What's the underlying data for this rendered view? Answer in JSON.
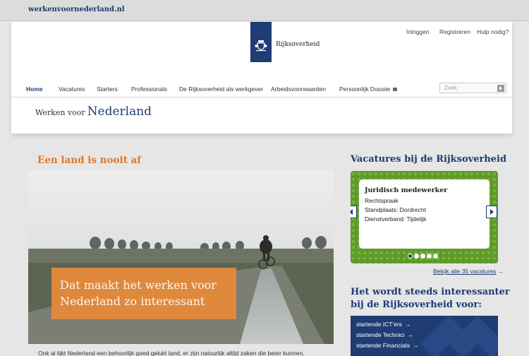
{
  "site_url": "werkenvoornederland.nl",
  "logo": {
    "text": "Rijksoverheid"
  },
  "utility_links": [
    "Inloggen",
    "Registreren",
    "Hulp nodig?"
  ],
  "nav": [
    {
      "label": "Home",
      "active": true
    },
    {
      "label": "Vacatures"
    },
    {
      "label": "Starters"
    },
    {
      "label": "Professionals"
    },
    {
      "label": "De Rijksoverheid als werkgever"
    },
    {
      "label": "Arbeidsvoorwaarden"
    },
    {
      "label": "Persoonlijk Dossier",
      "icon": "lock-icon"
    }
  ],
  "search": {
    "placeholder": "Zoek",
    "button_icon": "play-arrow-icon"
  },
  "tagline": {
    "small": "Werken voor",
    "big": "Nederland"
  },
  "main": {
    "title": "Een land is nooit af",
    "hero_caption_line1": "Dat maakt het werken voor",
    "hero_caption_line2": "Nederland zo interessant",
    "body_text": "Ook al lijkt Nederland een behoorlijk goed gelukt land, er zijn natuurlijk altijd zaken die beter kunnen."
  },
  "sidebar": {
    "vacatures_title": "Vacatures bij de Rijksoverheid",
    "vacancy": {
      "title": "Juridisch medewerker",
      "org": "Rechtspraak",
      "location": "Standplaats: Dordrecht",
      "employment": "Dienstverband: Tijdelijk"
    },
    "pager_count": 5,
    "pager_active": 0,
    "all_link": "Bekijk alle 35 vacatures",
    "interest_title_line1": "Het wordt steeds interessanter",
    "interest_title_line2": "bij de Rijksoverheid voor:",
    "interest_items": [
      "startende ICT'ers",
      "startende Technici",
      "startende Financials"
    ]
  },
  "colors": {
    "brand_blue": "#1f3c73",
    "accent_orange": "#e0782a",
    "green": "#5e9a2a"
  }
}
